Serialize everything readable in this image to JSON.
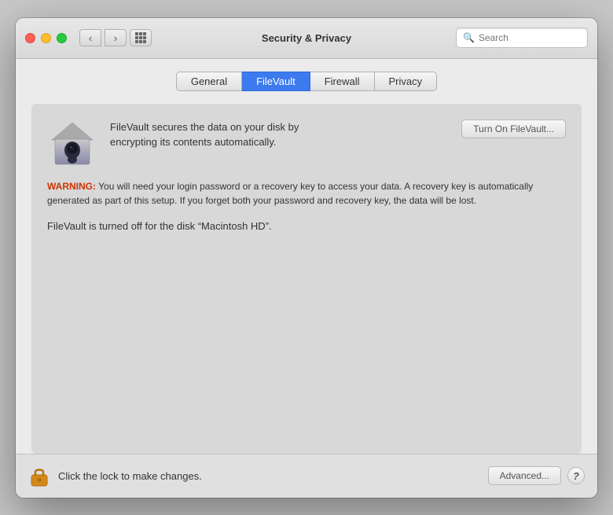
{
  "window": {
    "title": "Security & Privacy",
    "trafficLights": {
      "close": "close",
      "minimize": "minimize",
      "maximize": "maximize"
    }
  },
  "toolbar": {
    "search_placeholder": "Search"
  },
  "tabs": [
    {
      "id": "general",
      "label": "General",
      "active": false
    },
    {
      "id": "filevault",
      "label": "FileVault",
      "active": true
    },
    {
      "id": "firewall",
      "label": "Firewall",
      "active": false
    },
    {
      "id": "privacy",
      "label": "Privacy",
      "active": false
    }
  ],
  "filevault": {
    "description_line1": "FileVault secures the data on your disk by",
    "description_line2": "encrypting its contents automatically.",
    "warning_label": "WARNING:",
    "warning_text": " You will need your login password or a recovery key to access your data. A recovery key is automatically generated as part of this setup. If you forget both your password and recovery key, the data will be lost.",
    "status_text": "FileVault is turned off for the disk “Macintosh HD”.",
    "turn_on_button": "Turn On FileVault..."
  },
  "bottombar": {
    "lock_text": "Click the lock to make changes.",
    "advanced_button": "Advanced...",
    "help_button": "?"
  }
}
